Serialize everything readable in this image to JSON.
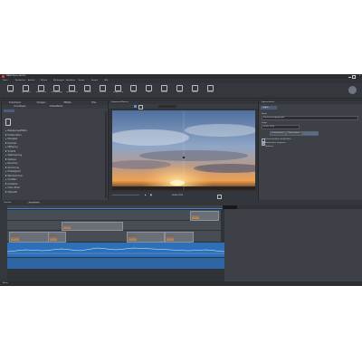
{
  "window": {
    "title": "MAGIX Movie Edit Pro"
  },
  "menu": [
    "Datei",
    "Bearbeiten",
    "Ansicht",
    "Effekte",
    "Wiedergabe",
    "Aufnahme",
    "Extras",
    "Fenster",
    "Hilfe"
  ],
  "toolbar": [
    {
      "label": "Öffnen",
      "icon": "folder-icon"
    },
    {
      "label": "Speichern",
      "icon": "save-icon"
    },
    {
      "label": "Exportieren",
      "icon": "export-icon"
    },
    {
      "label": "Rückgängig",
      "icon": "undo-icon"
    },
    {
      "label": "Wiederholen",
      "icon": "redo-icon"
    },
    {
      "label": "Trimmen",
      "icon": "trim-icon"
    },
    {
      "label": "Schnitt",
      "icon": "cut-icon"
    },
    {
      "label": "Gruppieren",
      "icon": "group-icon"
    },
    {
      "label": "Zoom",
      "icon": "zoom-icon"
    },
    {
      "label": "Text",
      "icon": "text-icon"
    },
    {
      "label": "Marker",
      "icon": "marker-icon"
    },
    {
      "label": "Video",
      "icon": "video-icon"
    },
    {
      "label": "Audio",
      "icon": "audio-icon"
    },
    {
      "label": "Effekte",
      "icon": "fx-icon"
    }
  ],
  "left_panel": {
    "tabs": [
      "Importieren",
      "Vorlagen",
      "Effekte",
      "Titel"
    ],
    "subtabs": [
      "Grundlagen",
      "Videoeffekte"
    ],
    "items": [
      "Bewegungseffekte",
      "Farbkorrektur",
      "Helligkeit",
      "Kontrast",
      "Sättigung",
      "Schärfe",
      "Stabilisierung",
      "Zeitlupe",
      "Rauschen",
      "Verzerrung",
      "Farbabgleich",
      "Weichzeichner",
      "Schatten",
      "Gradation",
      "Video-Mixer",
      "Stereo3D"
    ]
  },
  "preview": {
    "timecode": "00:00:17:05",
    "label": "Programm-Monitor"
  },
  "right_panel": {
    "title": "Eigenschaften",
    "section": "Objekt",
    "fields": [
      {
        "label": "Name",
        "value": "Sonnenuntergang.mp4"
      },
      {
        "label": "Länge",
        "value": "00:00:12:00"
      }
    ],
    "buttons": [
      "Zurücksetzen",
      "Übernehmen"
    ],
    "options": [
      "Seitenverhältnis beibehalten",
      "Automatisch anpassen",
      "Optionen"
    ]
  },
  "timeline": {
    "tabs": [
      "Timeline",
      "Storyboard"
    ],
    "tracks": 4,
    "status": "Bereit"
  }
}
